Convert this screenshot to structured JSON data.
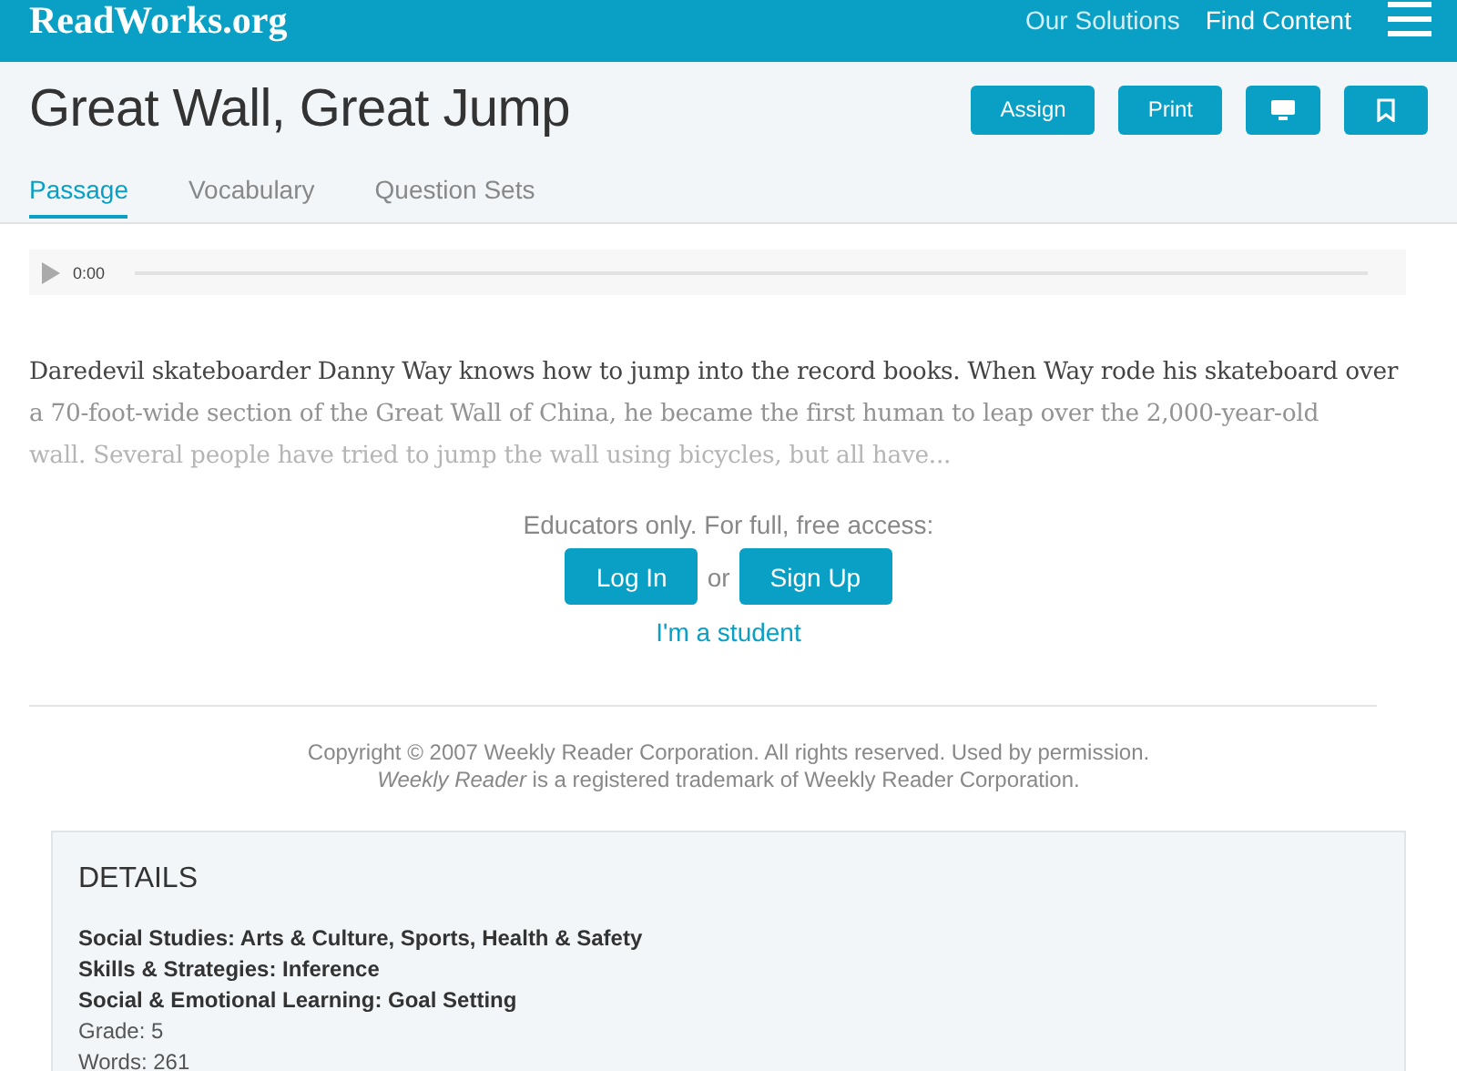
{
  "header": {
    "logo": "ReadWorks.org",
    "nav": [
      "Our Solutions",
      "Find Content"
    ]
  },
  "title": "Great Wall, Great Jump",
  "actions": [
    {
      "kind": "text",
      "label": "Assign"
    },
    {
      "kind": "text",
      "label": "Print"
    },
    {
      "kind": "monitor"
    },
    {
      "kind": "bookmark"
    }
  ],
  "tabs": [
    {
      "label": "Passage",
      "selected": true
    },
    {
      "label": "Vocabulary",
      "selected": false
    },
    {
      "label": "Question Sets",
      "selected": false
    }
  ],
  "audio": {
    "time": "0:00"
  },
  "passage": [
    "Daredevil skateboarder Danny Way knows how to jump into the record books. When Way rode his skateboard over",
    "a 70-foot-wide section of the Great Wall of China, he became the first human to leap over the 2,000-year-old",
    "wall. Several people have tried to jump the wall using bicycles, but all have..."
  ],
  "access": {
    "prompt": "Educators only. For full, free access:",
    "login": "Log In",
    "or": "or",
    "signup": "Sign Up",
    "student": "I'm a student"
  },
  "copyright": [
    "Copyright © 2007 Weekly Reader Corporation. All rights reserved. Used by permission.",
    "*Weekly Reader* is a registered trademark of Weekly Reader Corporation."
  ],
  "details": {
    "heading": "DETAILS",
    "items": [
      {
        "text": "Social Studies: Arts & Culture, Sports, Health & Safety",
        "bold": true
      },
      {
        "text": "Skills & Strategies: Inference",
        "bold": true
      },
      {
        "text": "Social & Emotional Learning: Goal Setting",
        "bold": true
      },
      {
        "text": "Grade: 5",
        "bold": false
      },
      {
        "text": "Words: 261",
        "bold": false
      }
    ]
  }
}
